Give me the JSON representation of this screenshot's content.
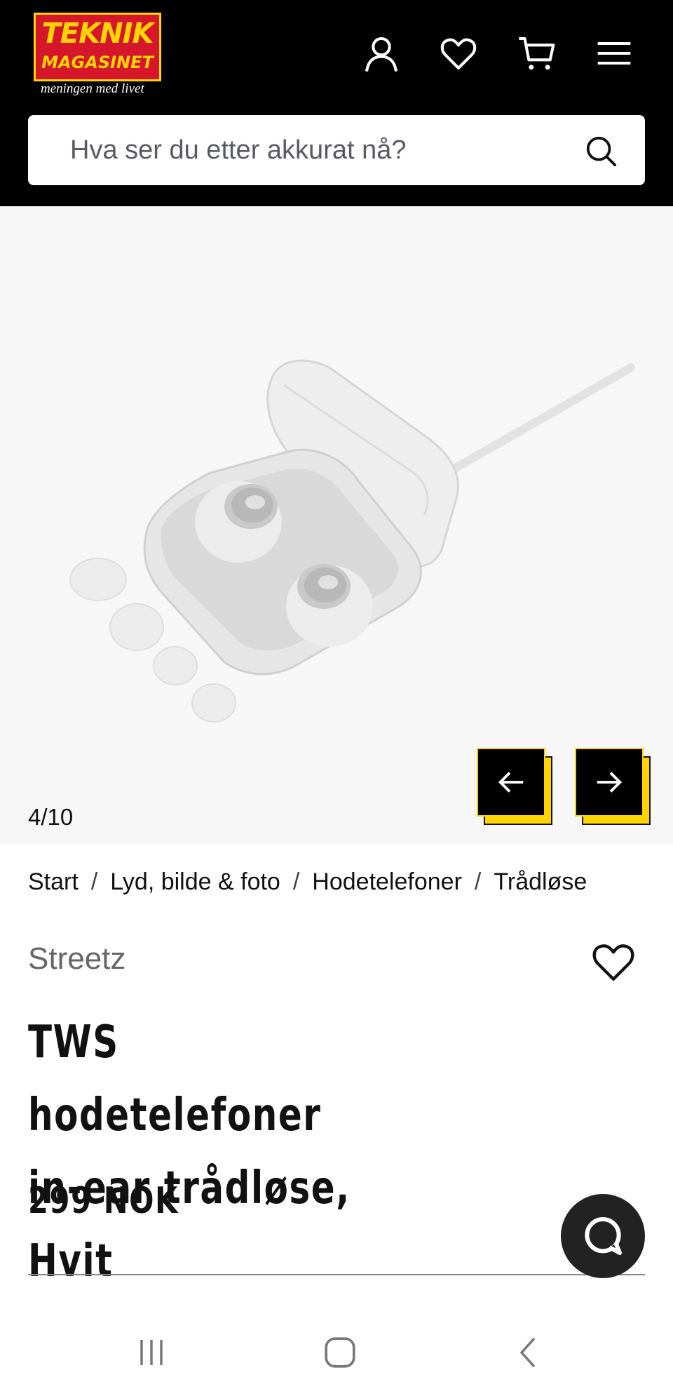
{
  "header": {
    "logo": {
      "line1": "TEKNIK",
      "line2": "MAGASINET",
      "tagline": "meningen med livet"
    },
    "icons": [
      "account-icon",
      "heart-icon",
      "cart-icon",
      "menu-icon"
    ]
  },
  "search": {
    "placeholder": "Hva ser du etter akkurat nå?",
    "icon": "search-icon"
  },
  "gallery": {
    "counter": "4/10",
    "prev_icon": "arrow-left-icon",
    "next_icon": "arrow-right-icon"
  },
  "breadcrumb": [
    "Start",
    "Lyd, bilde & foto",
    "Hodetelefoner",
    "Trådløse"
  ],
  "product": {
    "brand": "Streetz",
    "title": "TWS hodetelefoner in-ear trådløse, Hvit",
    "price": "299 NOK"
  },
  "chat": {
    "icon": "chat-icon"
  },
  "system_nav": [
    "recent-apps-icon",
    "home-icon",
    "back-icon"
  ],
  "colors": {
    "header_bg": "#000000",
    "accent_yellow": "#ffd400",
    "logo_red": "#d6162b",
    "gallery_bg": "#f7f7f7"
  }
}
